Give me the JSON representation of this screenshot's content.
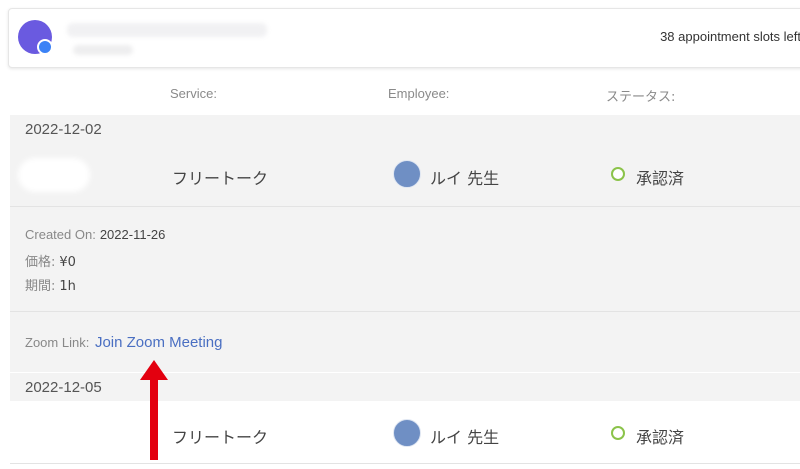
{
  "header": {
    "slots_left": "38 appointment slots left"
  },
  "columns": {
    "service": "Service:",
    "employee": "Employee:",
    "status": "ステータス:"
  },
  "appointments": [
    {
      "date": "2022-12-02",
      "service": "フリートーク",
      "employee": "ルイ 先生",
      "status": "承認済",
      "created_label": "Created On:",
      "created_value": "2022-11-26",
      "price_label": "価格:",
      "price_value": "¥0",
      "duration_label": "期間:",
      "duration_value": "1h",
      "zoom_label": "Zoom Link:",
      "zoom_link": "Join Zoom Meeting"
    },
    {
      "date": "2022-12-05",
      "service": "フリートーク",
      "employee": "ルイ 先生",
      "status": "承認済"
    }
  ],
  "colors": {
    "accent_link": "#4a6fc2",
    "status_approved": "#8bc34a",
    "annotation_arrow": "#e3000f"
  },
  "icons": [
    "user-avatar-icon",
    "employee-avatar-icon",
    "status-circle-icon",
    "red-arrow-annotation-icon"
  ]
}
